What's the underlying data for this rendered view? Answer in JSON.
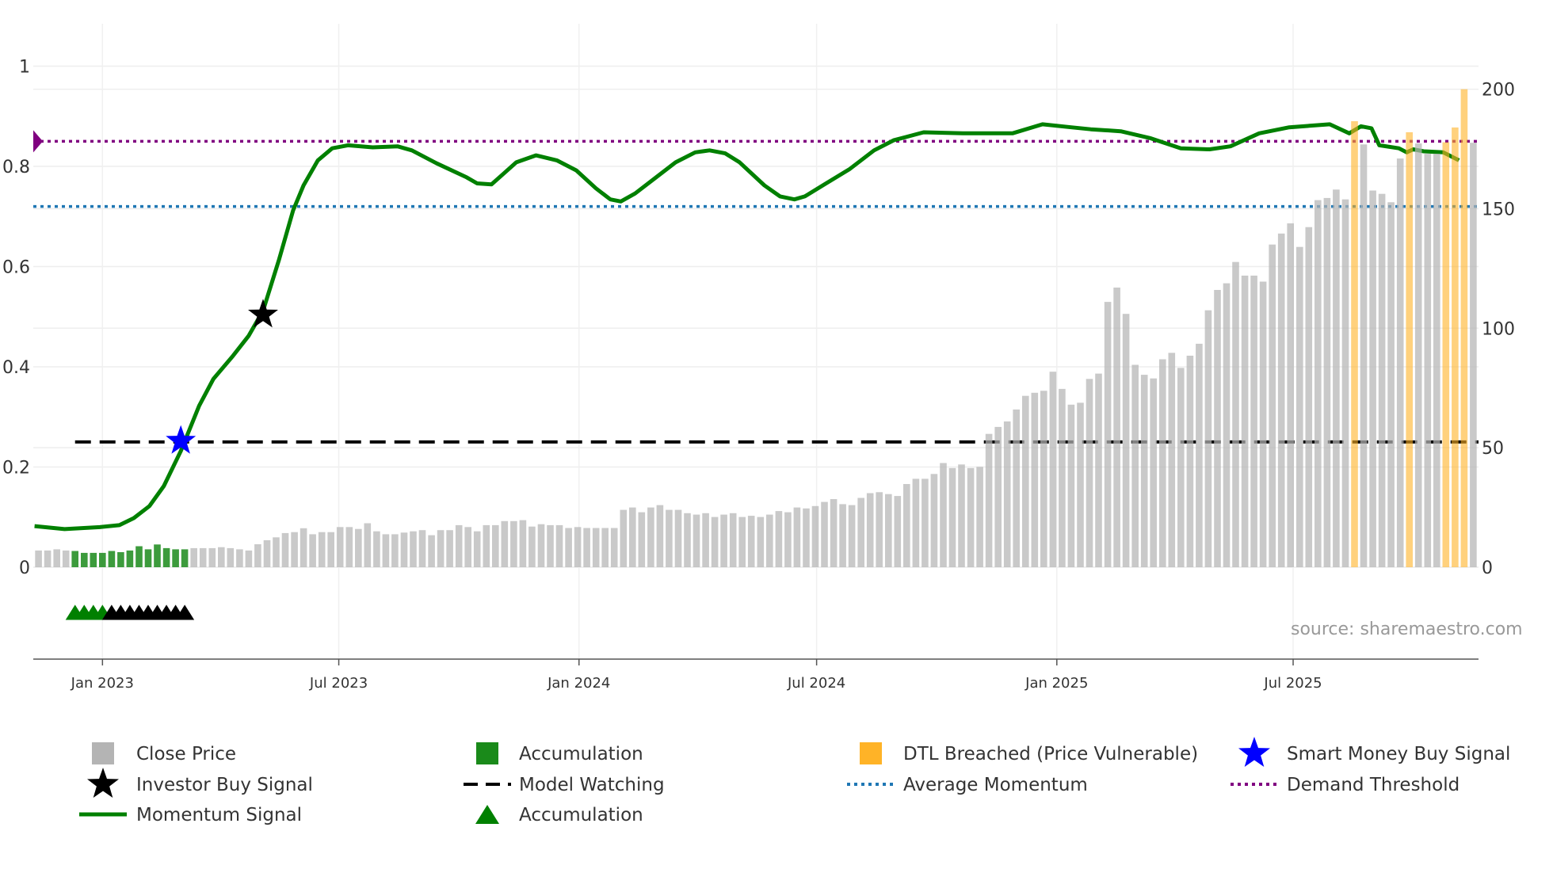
{
  "chart_data": {
    "type": "bar",
    "title": "",
    "xlabel": "",
    "ylabel_left": "",
    "ylabel_right": "",
    "x_range": [
      "2022-11-09",
      "2025-11-20"
    ],
    "y_left_range": [
      -0.184,
      1.06
    ],
    "y_right_range": [
      0,
      200
    ],
    "y_left_ticks": [
      0,
      0.2,
      0.4,
      0.6,
      0.8,
      1
    ],
    "y_left_tick_labels": [
      "0",
      "0.2",
      "0.4",
      "0.6",
      "0.8",
      "1"
    ],
    "y_right_ticks": [
      0,
      50,
      100,
      150,
      200
    ],
    "y_right_tick_labels": [
      "0",
      "50",
      "100",
      "150",
      "200"
    ],
    "x_ticks": [
      "2023-01-01",
      "2023-07-01",
      "2024-01-01",
      "2024-07-01",
      "2025-01-01",
      "2025-07-01"
    ],
    "x_tick_labels": [
      "Jan 2023",
      "Jul 2023",
      "Jan 2024",
      "Jul 2024",
      "Jan 2025",
      "Jul 2025"
    ],
    "grid": true,
    "legend_placement": "bottom",
    "colors": {
      "close_price": "#b4b4b4",
      "accumulation": "#1a8a1a",
      "dtl_breached": "#ffb327",
      "momentum": "#008000",
      "model_watching": "#000000",
      "average_momentum": "#1f77b4",
      "demand_threshold": "#800080",
      "smart_money_star": "#0000ff",
      "investor_star": "#000000"
    },
    "close_price": {
      "name": "Close Price",
      "axis": "right",
      "frequency": "weekly",
      "first_date": "2022-11-13",
      "values": [
        7,
        7,
        7.5,
        7,
        6.8,
        6,
        6,
        6,
        6.8,
        6.3,
        7,
        8.8,
        7.5,
        9.5,
        8,
        7.5,
        7.5,
        8,
        8,
        8,
        8.4,
        8,
        7.5,
        7,
        9.6,
        11.3,
        12.5,
        14.3,
        14.7,
        16.3,
        13.8,
        14.7,
        14.7,
        16.8,
        16.8,
        16,
        18.4,
        15,
        13.8,
        13.8,
        14.5,
        15,
        15.5,
        13.4,
        15.5,
        15.5,
        17.6,
        16.8,
        15,
        17.6,
        17.6,
        19.3,
        19.3,
        19.7,
        17,
        18,
        17.6,
        17.6,
        16.4,
        16.8,
        16.4,
        16.4,
        16.4,
        16.4,
        24,
        25,
        23,
        25,
        26,
        24,
        24,
        22.6,
        22,
        22.6,
        21,
        22,
        22.6,
        21,
        21.5,
        21,
        22,
        23.5,
        23,
        25,
        24.6,
        25.6,
        27.3,
        28.5,
        26.4,
        26,
        29,
        31,
        31.4,
        30.6,
        29.8,
        34.8,
        37,
        37,
        39,
        43.6,
        41.5,
        43,
        41.5,
        42,
        55.8,
        58.7,
        61,
        66,
        71.7,
        73,
        73.8,
        81.8,
        74.6,
        68,
        68.8,
        78.8,
        81,
        111,
        117,
        106,
        84.7,
        80.5,
        79,
        87,
        89.7,
        83.4,
        88.5,
        93.5,
        107.5,
        116,
        118.8,
        127.7,
        122,
        122,
        119.5,
        135,
        139.6,
        143.9,
        134,
        142.3,
        153.6,
        154.5,
        158,
        153.9,
        186.6,
        176.9,
        157.6,
        156.2,
        152.7,
        171,
        182,
        177.3,
        173,
        173,
        177.8,
        184,
        200,
        177.6
      ]
    },
    "accumulation_period": {
      "name": "Accumulation",
      "from": "2022-12-11",
      "to": "2023-03-05"
    },
    "dtl_breached_dates": {
      "name": "DTL Breached (Price Vulnerable)",
      "dates": [
        "2025-08-17",
        "2025-09-28",
        "2025-10-26",
        "2025-11-02",
        "2025-11-09"
      ]
    },
    "momentum": {
      "name": "Momentum Signal",
      "axis": "left",
      "points": [
        [
          "2022-11-10",
          0.082
        ],
        [
          "2022-12-03",
          0.076
        ],
        [
          "2022-12-30",
          0.08
        ],
        [
          "2023-01-14",
          0.084
        ],
        [
          "2023-01-25",
          0.098
        ],
        [
          "2023-02-06",
          0.122
        ],
        [
          "2023-02-17",
          0.162
        ],
        [
          "2023-03-02",
          0.232
        ],
        [
          "2023-03-16",
          0.322
        ],
        [
          "2023-03-27",
          0.376
        ],
        [
          "2023-04-11",
          0.422
        ],
        [
          "2023-04-23",
          0.462
        ],
        [
          "2023-05-04",
          0.512
        ],
        [
          "2023-05-16",
          0.612
        ],
        [
          "2023-05-27",
          0.712
        ],
        [
          "2023-06-04",
          0.762
        ],
        [
          "2023-06-15",
          0.812
        ],
        [
          "2023-06-26",
          0.836
        ],
        [
          "2023-07-08",
          0.842
        ],
        [
          "2023-07-27",
          0.838
        ],
        [
          "2023-08-15",
          0.84
        ],
        [
          "2023-08-26",
          0.832
        ],
        [
          "2023-09-14",
          0.806
        ],
        [
          "2023-10-07",
          0.778
        ],
        [
          "2023-10-15",
          0.766
        ],
        [
          "2023-10-26",
          0.764
        ],
        [
          "2023-11-14",
          0.808
        ],
        [
          "2023-11-29",
          0.822
        ],
        [
          "2023-12-15",
          0.812
        ],
        [
          "2023-12-30",
          0.792
        ],
        [
          "2024-01-14",
          0.756
        ],
        [
          "2024-01-25",
          0.734
        ],
        [
          "2024-02-02",
          0.73
        ],
        [
          "2024-02-13",
          0.746
        ],
        [
          "2024-02-29",
          0.778
        ],
        [
          "2024-03-15",
          0.808
        ],
        [
          "2024-03-30",
          0.828
        ],
        [
          "2024-04-10",
          0.832
        ],
        [
          "2024-04-22",
          0.826
        ],
        [
          "2024-05-03",
          0.808
        ],
        [
          "2024-05-22",
          0.762
        ],
        [
          "2024-06-03",
          0.74
        ],
        [
          "2024-06-14",
          0.734
        ],
        [
          "2024-06-22",
          0.74
        ],
        [
          "2024-07-07",
          0.764
        ],
        [
          "2024-07-26",
          0.794
        ],
        [
          "2024-08-14",
          0.832
        ],
        [
          "2024-08-29",
          0.852
        ],
        [
          "2024-09-21",
          0.868
        ],
        [
          "2024-10-21",
          0.866
        ],
        [
          "2024-11-28",
          0.866
        ],
        [
          "2024-12-21",
          0.884
        ],
        [
          "2025-01-12",
          0.878
        ],
        [
          "2025-01-27",
          0.874
        ],
        [
          "2025-02-19",
          0.87
        ],
        [
          "2025-03-14",
          0.856
        ],
        [
          "2025-04-06",
          0.836
        ],
        [
          "2025-04-28",
          0.834
        ],
        [
          "2025-05-14",
          0.84
        ],
        [
          "2025-06-05",
          0.866
        ],
        [
          "2025-06-28",
          0.878
        ],
        [
          "2025-07-29",
          0.884
        ],
        [
          "2025-08-13",
          0.866
        ],
        [
          "2025-08-22",
          0.88
        ],
        [
          "2025-08-30",
          0.876
        ],
        [
          "2025-09-05",
          0.842
        ],
        [
          "2025-09-20",
          0.836
        ],
        [
          "2025-09-26",
          0.828
        ],
        [
          "2025-10-01",
          0.834
        ],
        [
          "2025-10-09",
          0.83
        ],
        [
          "2025-10-24",
          0.828
        ],
        [
          "2025-11-05",
          0.812
        ]
      ]
    },
    "model_watching": {
      "name": "Model Watching",
      "value": 0.25,
      "from": "2022-12-11"
    },
    "average_momentum": {
      "name": "Average Momentum",
      "value": 0.72
    },
    "demand_threshold": {
      "name": "Demand Threshold",
      "value": 0.85
    },
    "smart_money_buy_signal": {
      "name": "Smart Money Buy Signal",
      "date": "2023-03-02",
      "value": 0.252
    },
    "investor_buy_signal": {
      "name": "Investor Buy Signal",
      "date": "2023-05-04",
      "value": 0.504
    },
    "accumulation_markers": {
      "name": "Accumulation",
      "value": -0.09,
      "dates": [
        "2022-12-11",
        "2022-12-18",
        "2022-12-25",
        "2023-01-01"
      ]
    },
    "investor_markers": {
      "value": -0.09,
      "dates": [
        "2023-01-08",
        "2023-01-15",
        "2023-01-22",
        "2023-01-29",
        "2023-02-05",
        "2023-02-12",
        "2023-02-19",
        "2023-02-26",
        "2023-03-05"
      ]
    },
    "legend": [
      "Close Price",
      "Accumulation",
      "DTL Breached (Price Vulnerable)",
      "Smart Money Buy Signal",
      "Investor Buy Signal",
      "Model Watching",
      "Average Momentum",
      "Demand Threshold",
      "Momentum Signal",
      "Accumulation"
    ],
    "source": "source: sharemaestro.com"
  }
}
